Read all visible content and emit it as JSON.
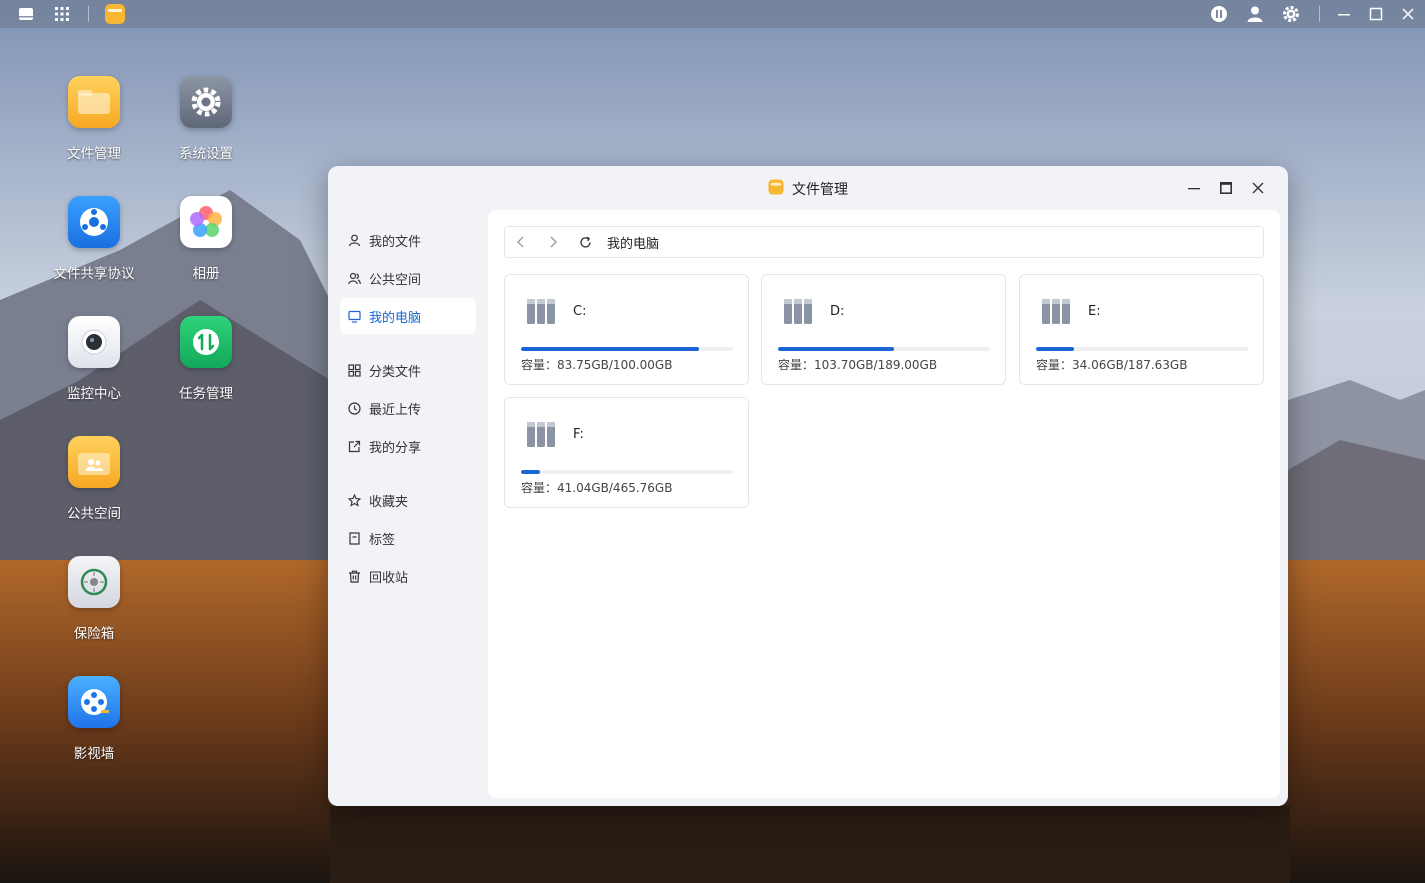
{
  "desktop": {
    "icons": [
      {
        "label": "文件管理",
        "icon": "folder-icon"
      },
      {
        "label": "系统设置",
        "icon": "gear-icon"
      },
      {
        "label": "文件共享协议",
        "icon": "share-protocol-icon"
      },
      {
        "label": "相册",
        "icon": "photos-icon"
      },
      {
        "label": "监控中心",
        "icon": "camera-icon"
      },
      {
        "label": "任务管理",
        "icon": "task-icon"
      },
      {
        "label": "公共空间",
        "icon": "public-folder-icon"
      },
      {
        "label": "保险箱",
        "icon": "safe-icon"
      },
      {
        "label": "影视墙",
        "icon": "video-icon"
      }
    ]
  },
  "window": {
    "title": "文件管理",
    "sidebar": {
      "group1": [
        "我的文件",
        "公共空间",
        "我的电脑"
      ],
      "group2": [
        "分类文件",
        "最近上传",
        "我的分享"
      ],
      "group3": [
        "收藏夹",
        "标签",
        "回收站"
      ],
      "active": "我的电脑"
    },
    "address": {
      "path": "我的电脑"
    },
    "drives": [
      {
        "name": "C:",
        "capacity": "容量：83.75GB/100.00GB",
        "used_fraction": 0.8375
      },
      {
        "name": "D:",
        "capacity": "容量：103.70GB/189.00GB",
        "used_fraction": 0.5487
      },
      {
        "name": "E:",
        "capacity": "容量：34.06GB/187.63GB",
        "used_fraction": 0.1815
      },
      {
        "name": "F:",
        "capacity": "容量：41.04GB/465.76GB",
        "used_fraction": 0.0881
      }
    ]
  },
  "colors": {
    "accent": "#1a66d6"
  }
}
